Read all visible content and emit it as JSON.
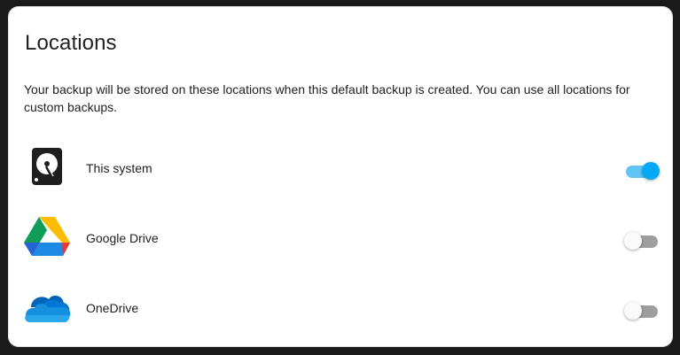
{
  "card": {
    "title": "Locations",
    "description": "Your backup will be stored on these locations when this default backup is created. You can use all locations for custom backups."
  },
  "locations": [
    {
      "icon": "hard-drive-icon",
      "label": "This system",
      "enabled": true
    },
    {
      "icon": "google-drive-icon",
      "label": "Google Drive",
      "enabled": false
    },
    {
      "icon": "onedrive-icon",
      "label": "OneDrive",
      "enabled": false
    }
  ],
  "colors": {
    "toggle_on_thumb": "#03a9f4",
    "toggle_on_track": "#61c4f5",
    "toggle_off_track": "#9e9e9e"
  }
}
